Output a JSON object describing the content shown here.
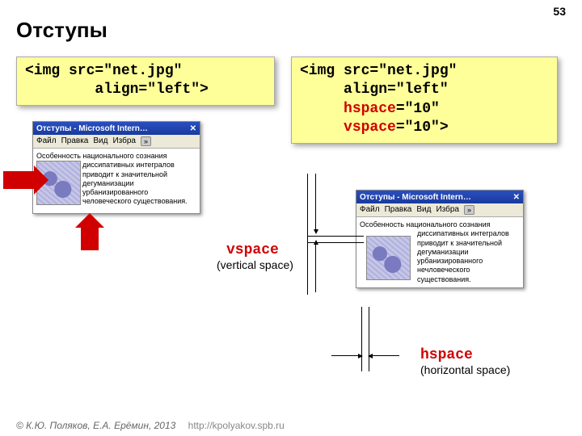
{
  "slide_number": "53",
  "title": "Отступы",
  "code_left": "<img src=\"net.jpg\" \n        align=\"left\">",
  "code_right_p1": "<img src=\"net.jpg\" \n     align=\"left\"\n     ",
  "code_right_hspace": "hspace",
  "code_right_hspace_tail": "=\"10\"",
  "code_right_vspace": "     ",
  "code_right_vspace_w": "vspace",
  "code_right_vspace_tail": "=\"10\">",
  "browser_title": "Отступы - Microsoft Intern…",
  "menu": {
    "file": "Файл",
    "edit": "Правка",
    "view": "Вид",
    "fav": "Избра",
    "more": "»"
  },
  "para1_head": "Особенность национального сознания диссипативных ",
  "para1_tail": "интегралов приводит к значительной дегуманизации урбанизированного человеческого существования.",
  "para2_head": "Особенность национального сознания диссипативных",
  "para2_tail": "интегралов приводит к значительной дегуманизации урбанизированного нечловеческого существования.",
  "vspace_label": "vspace",
  "vspace_sub": "(vertical space)",
  "hspace_label": "hspace",
  "hspace_sub": "(horizontal space)",
  "footer_author": "© К.Ю. Поляков, Е.А. Ерёмин, 2013",
  "footer_url": "http://kpolyakov.spb.ru"
}
